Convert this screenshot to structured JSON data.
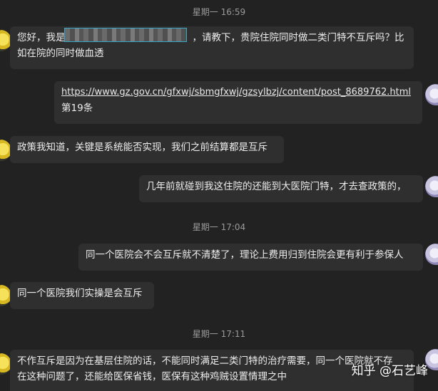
{
  "timestamps": [
    "星期一 16:59",
    "星期一 17:04",
    "星期一 17:11"
  ],
  "messages": [
    {
      "side": "left",
      "lines": [
        "您好，我是",
        "，请教下，贵院住院同时做二类门特不互斥吗？比",
        "如在院的同时做血透"
      ]
    },
    {
      "side": "right",
      "link": "https://www.gz.gov.cn/gfxwj/sbmgfxwj/gzsylbzj/content/post_8689762.html",
      "lines": [
        "第19条"
      ]
    },
    {
      "side": "left",
      "lines": [
        "政策我知道，关键是系统能否实现，我们之前结算都是互斥"
      ]
    },
    {
      "side": "right",
      "lines": [
        "几年前就碰到我这住院的还能到大医院门特，才去查政策的，"
      ]
    },
    {
      "side": "right",
      "lines": [
        "同一个医院会不会互斥就不清楚了，理论上费用归到住院会更有利于参保人"
      ]
    },
    {
      "side": "left",
      "lines": [
        "同一个医院我们实操是会互斥"
      ]
    },
    {
      "side": "left",
      "lines": [
        "不作互斥是因为在基层住院的话，不能同时满足二类门特的治疗需要，同一个医院就不存",
        "在这种问题了，还能给医保省钱，医保有这种鸡贼设置情理之中"
      ]
    }
  ],
  "watermark": "知乎 @石艺峰",
  "icons": {
    "left_avatar": "user-avatar-yellow",
    "right_avatar": "user-avatar-anime"
  }
}
